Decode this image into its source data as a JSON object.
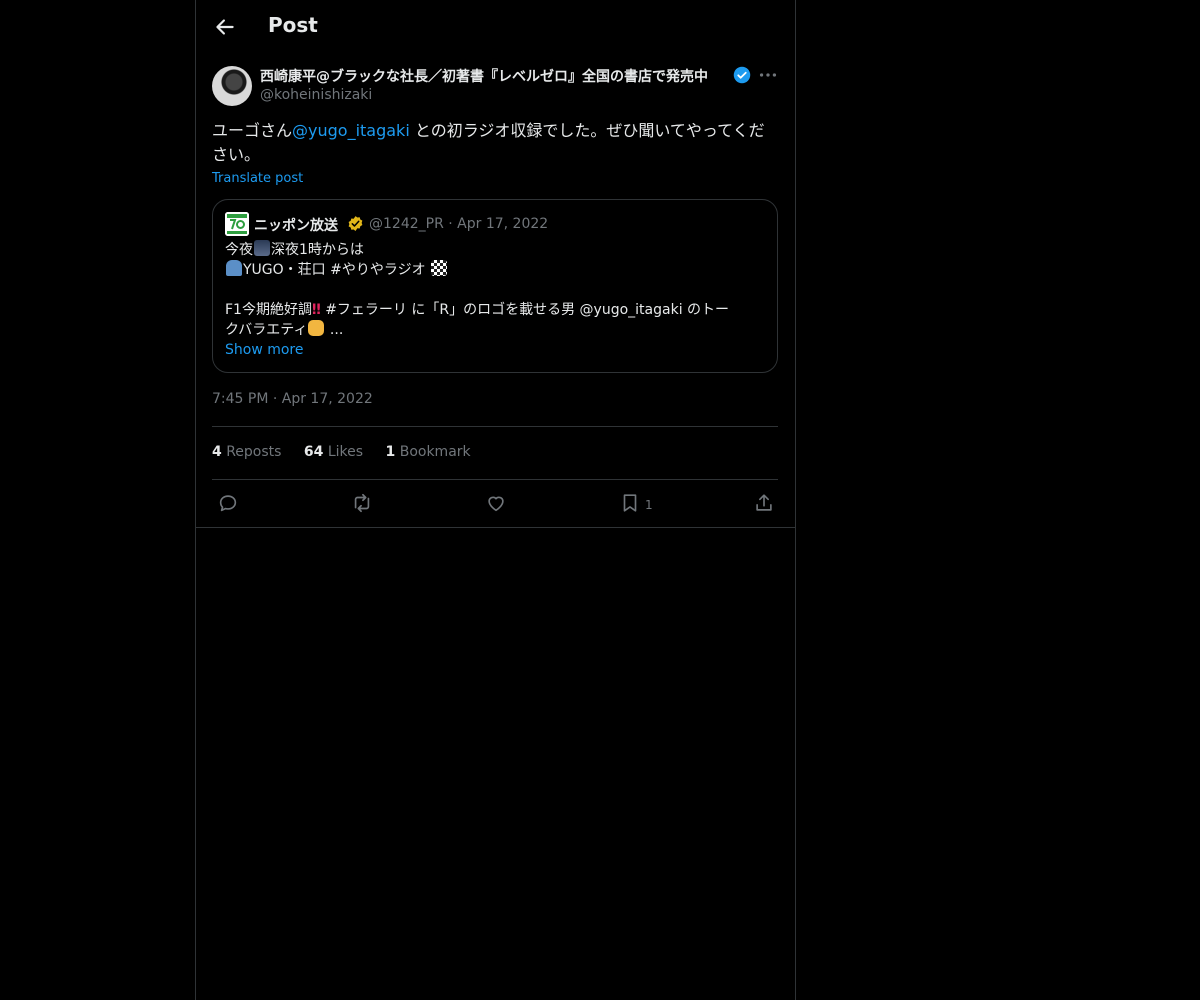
{
  "header": {
    "title": "Post"
  },
  "author": {
    "display_name": "西崎康平@ブラックな社長／初著書『レベルゼロ』全国の書店で発売中",
    "handle": "@koheinishizaki"
  },
  "post": {
    "text_before": "ユーゴさん",
    "mention": "@yugo_itagaki",
    "text_after": " との初ラジオ収録でした。ぜひ聞いてやってください。",
    "translate_label": "Translate post",
    "timestamp": "7:45 PM · Apr 17, 2022"
  },
  "quote": {
    "name": "ニッポン放送",
    "handle_date": "@1242_PR · Apr 17, 2022",
    "line1_a": "今夜",
    "line1_b": "深夜1時からは",
    "line2": "YUGO・荘口 #やりやラジオ",
    "line3_a": "F1今期絶好調",
    "line3_b": " #フェラーリ に「R」のロゴを載せる男 @yugo_itagaki のトー",
    "line4": "クバラエティ",
    "line4_end": " ...",
    "show_more": "Show more"
  },
  "stats": {
    "reposts_count": "4",
    "reposts_label": "Reposts",
    "likes_count": "64",
    "likes_label": "Likes",
    "bookmarks_count": "1",
    "bookmarks_label": "Bookmark"
  },
  "actions": {
    "bookmark_count": "1"
  },
  "colors": {
    "accent": "#1d9bf0",
    "background": "#000000",
    "divider": "#2f3336",
    "muted": "#71767b"
  },
  "icons": [
    "back-arrow-icon",
    "verified-icon",
    "more-icon",
    "gold-verified-icon",
    "reply-icon",
    "repost-icon",
    "like-icon",
    "bookmark-icon",
    "share-icon"
  ]
}
